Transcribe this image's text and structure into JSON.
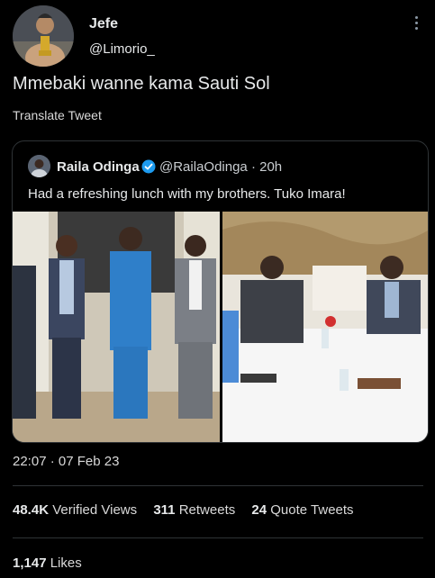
{
  "tweet": {
    "author_name": "Jefe",
    "author_handle": "@Limorio_",
    "text": "Mmebaki wanne kama Sauti Sol",
    "translate_label": "Translate Tweet",
    "timestamp": "22:07 · 07 Feb 23"
  },
  "quoted_tweet": {
    "author_name": "Raila Odinga",
    "author_handle": "@RailaOdinga",
    "separator": "·",
    "age": "20h",
    "text": "Had a refreshing lunch with my brothers. Tuko Imara!"
  },
  "stats": {
    "views_count": "48.4K",
    "views_label": "Verified Views",
    "retweets_count": "311",
    "retweets_label": "Retweets",
    "quotes_count": "24",
    "quotes_label": "Quote Tweets",
    "likes_count": "1,147",
    "likes_label": "Likes"
  },
  "icons": {
    "more": "more-vertical-icon",
    "verified": "verified-badge-icon"
  },
  "colors": {
    "background": "#000000",
    "text": "#e7e9ea",
    "secondary": "#8b98a5",
    "border": "#2f3336",
    "verified": "#1d9bf0"
  }
}
